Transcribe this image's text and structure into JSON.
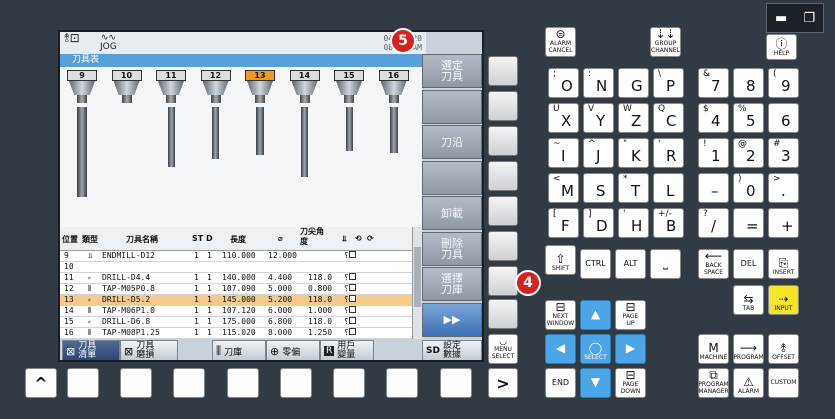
{
  "window": {
    "minimize": "▬",
    "restore": "❐"
  },
  "screen": {
    "title": "刀具表",
    "datetime": {
      "date": "04/14/20",
      "time": "08:37 AM"
    },
    "mode_label": "JOG",
    "tool_slots": [
      "9",
      "10",
      "11",
      "12",
      "13",
      "14",
      "15",
      "16"
    ],
    "selected_slot": "13",
    "table": {
      "headers": [
        "位置",
        "類型",
        "刀具名稱",
        "ST",
        "D",
        "長度",
        "⌀",
        "刀尖角度",
        "⫫",
        "⟲",
        "⟳"
      ],
      "rows": [
        {
          "pos": "9",
          "type": "⫫",
          "name": "ENDMILL-D12",
          "st": "1",
          "d": "1",
          "len": "110.000",
          "dia": "12.000",
          "ang": "",
          "hl": false
        },
        {
          "pos": "10",
          "type": "",
          "name": "",
          "st": "",
          "d": "",
          "len": "",
          "dia": "",
          "ang": "",
          "hl": false
        },
        {
          "pos": "11",
          "type": "⸗",
          "name": "DRILL-D4.4",
          "st": "1",
          "d": "1",
          "len": "140.000",
          "dia": "4.400",
          "ang": "118.0",
          "hl": false
        },
        {
          "pos": "12",
          "type": "⫴",
          "name": "TAP-M05P0.8",
          "st": "1",
          "d": "1",
          "len": "107.090",
          "dia": "5.000",
          "ang": "0.800",
          "hl": false
        },
        {
          "pos": "13",
          "type": "⸗",
          "name": "DRILL-D5.2",
          "st": "1",
          "d": "1",
          "len": "145.000",
          "dia": "5.200",
          "ang": "118.0",
          "hl": true
        },
        {
          "pos": "14",
          "type": "⫴",
          "name": "TAP-M06P1.0",
          "st": "1",
          "d": "1",
          "len": "107.120",
          "dia": "6.000",
          "ang": "1.000",
          "hl": false
        },
        {
          "pos": "15",
          "type": "⸗",
          "name": "DRILL-D6.8",
          "st": "1",
          "d": "1",
          "len": "175.000",
          "dia": "6.800",
          "ang": "118.0",
          "hl": false
        },
        {
          "pos": "16",
          "type": "⫴",
          "name": "TAP-M08P1.25",
          "st": "1",
          "d": "1",
          "len": "115.020",
          "dia": "8.000",
          "ang": "1.250",
          "hl": false
        }
      ]
    },
    "right_softkeys": [
      "選定\n刀具",
      "",
      "刀沿",
      "",
      "卸載",
      "刪除\n刀具",
      "選擇\n刀庫",
      "▶▶"
    ],
    "bottom_softkeys": [
      "刀具\n清單",
      "刀具\n磨損",
      "刀庫",
      "零偏",
      "用戶\n變量",
      "設定\n數據"
    ],
    "bottom_prefix": {
      "r": "R",
      "sd": "SD"
    }
  },
  "outer": {
    "bottom_keys": [
      "^",
      "",
      "",
      "",
      "",
      "",
      "",
      "",
      ">"
    ],
    "menu_select": "MENU\nSELECT"
  },
  "keyboard": {
    "alarm_cancel": "ALARM\nCANCEL",
    "group_channel": "GROUP\nCHANNEL",
    "help": "HELP",
    "letters": [
      {
        "t": ";",
        "m": "O"
      },
      {
        "t": ":",
        "m": "N"
      },
      {
        "t": "",
        "m": "G"
      },
      {
        "t": "\\",
        "m": "P"
      },
      {
        "t": "U",
        "m": "X"
      },
      {
        "t": "V",
        "m": "Y"
      },
      {
        "t": "W",
        "m": "Z"
      },
      {
        "t": "Q",
        "m": "C"
      },
      {
        "t": "~",
        "m": "I"
      },
      {
        "t": "^",
        "m": "J"
      },
      {
        "t": "\"",
        "m": "K"
      },
      {
        "t": "'",
        "m": "R"
      },
      {
        "t": "<",
        "m": "M"
      },
      {
        "t": "",
        "m": "S"
      },
      {
        "t": "*",
        "m": "T"
      },
      {
        "t": "",
        "m": "L"
      },
      {
        "t": "[",
        "m": "F"
      },
      {
        "t": "]",
        "m": "D"
      },
      {
        "t": "'",
        "m": "H"
      },
      {
        "t": "+/-",
        "m": "B"
      }
    ],
    "numbers": [
      {
        "t": "&",
        "m": "7"
      },
      {
        "t": "",
        "m": "8"
      },
      {
        "t": "(",
        "m": "9"
      },
      {
        "t": "$",
        "m": "4"
      },
      {
        "t": "%",
        "m": "5"
      },
      {
        "t": "",
        "m": "6"
      },
      {
        "t": "!",
        "m": "1"
      },
      {
        "t": "@",
        "m": "2"
      },
      {
        "t": "#",
        "m": "3"
      },
      {
        "t": "",
        "m": "–"
      },
      {
        "t": ")",
        "m": "0"
      },
      {
        "t": ">",
        "m": "."
      },
      {
        "t": "?",
        "m": "/"
      },
      {
        "t": "",
        "m": "="
      },
      {
        "t": "",
        "m": "+"
      }
    ],
    "func1": [
      "SHIFT",
      "CTRL",
      "ALT",
      ""
    ],
    "func2": [
      "BACK\nSPACE",
      "DEL",
      "INSERT"
    ],
    "tab": "TAB",
    "input": "INPUT",
    "next_window": "NEXT\nWINDOW",
    "page_up": "PAGE\nUP",
    "select": "SELECT",
    "end": "END",
    "page_down": "PAGE\nDOWN",
    "machine": "MACHINE",
    "program": "PROGRAM",
    "offset": "OFFSET",
    "program_manager": "PROGRAM\nMANAGER",
    "alarm": "ALARM",
    "custom": "CUSTOM"
  },
  "badges": {
    "b4": "4",
    "b5": "5"
  },
  "colors": {
    "accent_blue": "#4aa6e6",
    "input_yellow": "#f6e526",
    "badge_red": "#d6211e",
    "highlight": "#f39a1c"
  }
}
